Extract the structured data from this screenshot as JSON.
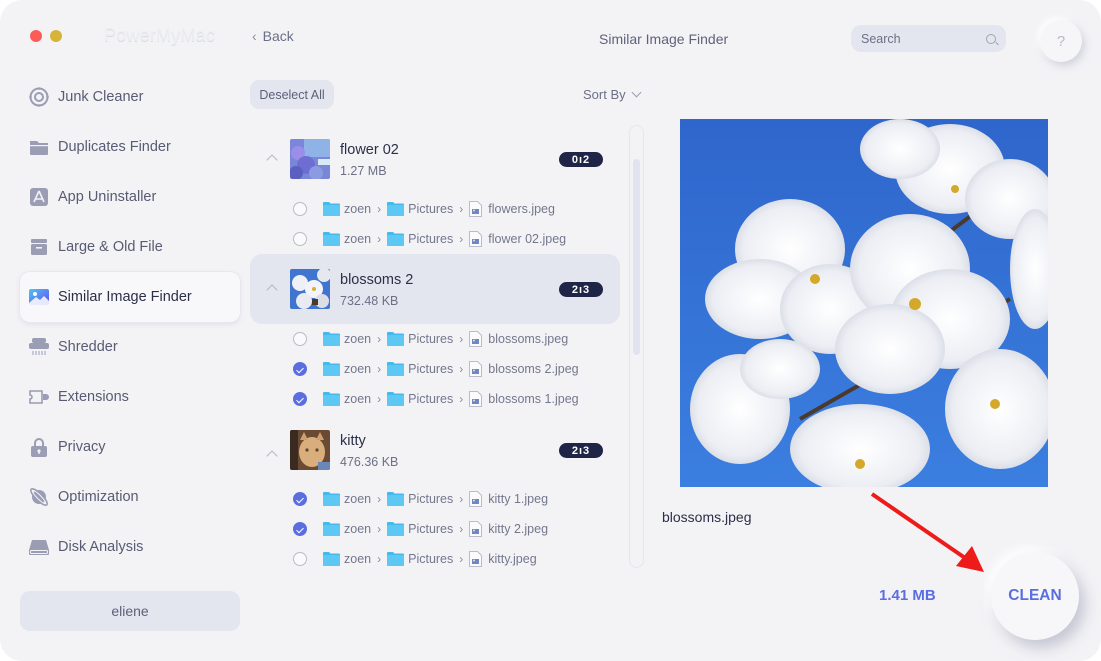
{
  "app": {
    "brand": "PowerMyMac",
    "back_label": "Back",
    "title": "Similar Image Finder",
    "search_placeholder": "Search",
    "help_label": "?"
  },
  "sidebar": {
    "items": [
      {
        "label": "Junk Cleaner",
        "icon": "junk-cleaner-icon"
      },
      {
        "label": "Duplicates Finder",
        "icon": "folder-icon"
      },
      {
        "label": "App Uninstaller",
        "icon": "app-store-icon"
      },
      {
        "label": "Large & Old File",
        "icon": "archive-box-icon"
      },
      {
        "label": "Similar Image Finder",
        "icon": "image-icon",
        "active": true
      },
      {
        "label": "Shredder",
        "icon": "shredder-icon"
      },
      {
        "label": "Extensions",
        "icon": "extension-plug-icon"
      },
      {
        "label": "Privacy",
        "icon": "lock-icon"
      },
      {
        "label": "Optimization",
        "icon": "planet-icon"
      },
      {
        "label": "Disk Analysis",
        "icon": "disk-icon"
      }
    ],
    "user": "eliene"
  },
  "toolbar": {
    "deselect_all": "Deselect All",
    "sort_by": "Sort By"
  },
  "groups": [
    {
      "title": "flower 02",
      "size": "1.27 MB",
      "badge": "0ı2",
      "selected": false,
      "files": [
        {
          "checked": false,
          "path": [
            "zoen",
            "Pictures"
          ],
          "name": "flowers.jpeg"
        },
        {
          "checked": false,
          "path": [
            "zoen",
            "Pictures"
          ],
          "name": "flower 02.jpeg"
        }
      ]
    },
    {
      "title": "blossoms 2",
      "size": "732.48 KB",
      "badge": "2ı3",
      "selected": true,
      "files": [
        {
          "checked": false,
          "path": [
            "zoen",
            "Pictures"
          ],
          "name": "blossoms.jpeg"
        },
        {
          "checked": true,
          "path": [
            "zoen",
            "Pictures"
          ],
          "name": "blossoms 2.jpeg"
        },
        {
          "checked": true,
          "path": [
            "zoen",
            "Pictures"
          ],
          "name": "blossoms 1.jpeg"
        }
      ]
    },
    {
      "title": "kitty",
      "size": "476.36 KB",
      "badge": "2ı3",
      "selected": false,
      "files": [
        {
          "checked": true,
          "path": [
            "zoen",
            "Pictures"
          ],
          "name": "kitty 1.jpeg"
        },
        {
          "checked": true,
          "path": [
            "zoen",
            "Pictures"
          ],
          "name": "kitty 2.jpeg"
        },
        {
          "checked": false,
          "path": [
            "zoen",
            "Pictures"
          ],
          "name": "kitty.jpeg"
        }
      ]
    }
  ],
  "preview": {
    "filename": "blossoms.jpeg"
  },
  "footer": {
    "total_size": "1.41 MB",
    "clean_label": "CLEAN"
  },
  "colors": {
    "accent": "#5b6ee0",
    "badge_bg": "#1f2547",
    "annotation_arrow": "#ee1b1b"
  }
}
